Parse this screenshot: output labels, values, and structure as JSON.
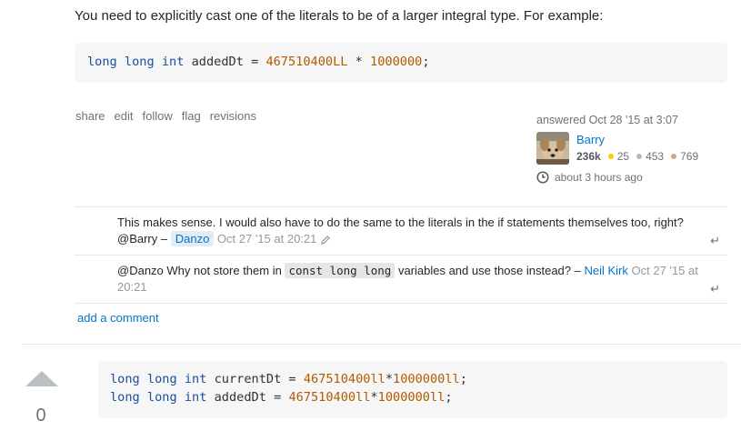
{
  "answer1": {
    "intro": "You need to explicitly cast one of the literals to be of a larger integral type. For example:",
    "code": {
      "kw": "long long int",
      "ident": " addedDt = ",
      "num1": "467510400LL",
      "op": " * ",
      "num2": "1000000",
      "end": ";"
    },
    "menu": [
      "share",
      "edit",
      "follow",
      "flag",
      "revisions"
    ],
    "user": {
      "action": "answered Oct 28 '15 at 3:07",
      "name": "Barry",
      "reputation": "236k",
      "gold": "25",
      "silver": "453",
      "bronze": "769",
      "activity": "about 3 hours ago"
    },
    "comments": [
      {
        "text": "This makes sense. I would also have to do the same to the literals in the if statements themselves too, right? @Barry – ",
        "author": "Danzo",
        "date": "Oct 27 '15 at 20:21"
      },
      {
        "text_before": "@Danzo Why not store them in ",
        "code": "const long long",
        "text_after": " variables and use those instead? – ",
        "author": "Neil Kirk",
        "date": "Oct 27 '15 at 20:21"
      }
    ],
    "add_comment": "add a comment"
  },
  "answer2": {
    "vote_count": "0",
    "code_lines": [
      {
        "kw": "long long int",
        "ident": " currentDt = ",
        "num1": "467510400ll",
        "op": "*",
        "num2": "1000000ll",
        "end": ";"
      },
      {
        "kw": "long long int",
        "ident": " addedDt = ",
        "num1": "467510400ll",
        "op": "*",
        "num2": "1000000ll",
        "end": ";"
      }
    ]
  },
  "colors": {
    "link": "#0074cc",
    "muted": "#6a737c",
    "code_bg": "#f6f6f6",
    "keyword": "#1a4fa0",
    "number": "#b35a00"
  }
}
